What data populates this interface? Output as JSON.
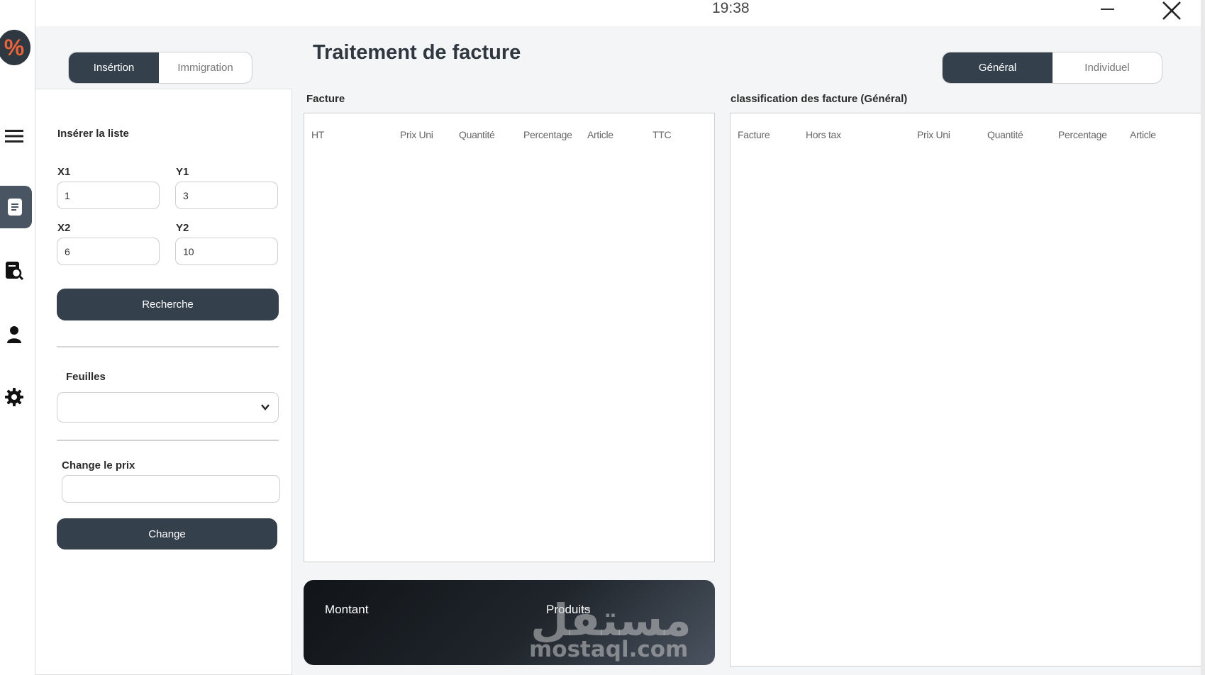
{
  "titlebar": {
    "time": "19:38"
  },
  "sidebar": {
    "items": [
      {
        "name": "menu"
      },
      {
        "name": "document"
      },
      {
        "name": "search-document"
      },
      {
        "name": "user"
      },
      {
        "name": "settings"
      }
    ],
    "logo_glyph": "%"
  },
  "left_tabs": {
    "insertion": "Insértion",
    "immigration": "Immigration"
  },
  "insert": {
    "heading": "Insérer la liste",
    "x1_label": "X1",
    "x1_value": "1",
    "y1_label": "Y1",
    "y1_value": "3",
    "x2_label": "X2",
    "x2_value": "6",
    "y2_label": "Y2",
    "y2_value": "10",
    "search_button": "Recherche"
  },
  "sheets": {
    "label": "Feuilles",
    "selected": ""
  },
  "price": {
    "label": "Change le prix",
    "value": "",
    "button": "Change"
  },
  "page_title": "Traitement de facture",
  "view_tabs": {
    "general": "Général",
    "individual": "Individuel"
  },
  "facture_table": {
    "title": "Facture",
    "columns": [
      "HT",
      "Prix Uni",
      "Quantité",
      "Percentage",
      "Article",
      "TTC"
    ]
  },
  "classification_table": {
    "title": "classification des facture (Général)",
    "columns": [
      "Facture",
      "Hors tax",
      "Prix Uni",
      "Quantité",
      "Percentage",
      "Article"
    ]
  },
  "summary": {
    "amount_label": "Montant",
    "products_label": "Produits"
  },
  "watermark": {
    "arabic": "مستقل",
    "latin": "mostaql.com"
  },
  "colors": {
    "dark": "#35404d",
    "accent_logo": "#e8643a",
    "background": "#f4f5f6"
  }
}
